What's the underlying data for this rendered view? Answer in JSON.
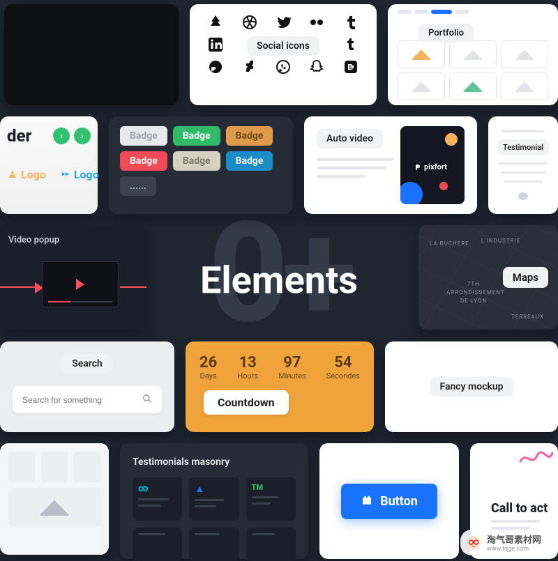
{
  "page": {
    "background_number": "0+",
    "title": "Elements"
  },
  "social": {
    "label": "Social icons"
  },
  "portfolio": {
    "label": "Portfolio"
  },
  "slider": {
    "title_fragment": "der",
    "logo_text": "Logo"
  },
  "badges": {
    "items": [
      {
        "text": "Badge",
        "bg": "#e6e8ec",
        "fg": "#9aa1ad"
      },
      {
        "text": "Badge",
        "bg": "#2fb968",
        "fg": "#ffffff"
      },
      {
        "text": "Badge",
        "bg": "#e09a4c",
        "fg": "#6b4518"
      },
      {
        "text": "Badge",
        "bg": "#ef4a56",
        "fg": "#ffffff"
      },
      {
        "text": "Badge",
        "bg": "#d6d1c1",
        "fg": "#7a7569"
      },
      {
        "text": "Badge",
        "bg": "#1c8cc9",
        "fg": "#ffffff"
      },
      {
        "text": "......",
        "bg": "#3a424f",
        "fg": "#aeb4bd"
      }
    ]
  },
  "auto_video": {
    "label": "Auto video",
    "brand": "pixfort"
  },
  "testimonial": {
    "label": "Testimonial"
  },
  "video_popup": {
    "label": "Video popup"
  },
  "maps": {
    "label": "Maps",
    "streets": [
      "LA BUCHÈRE",
      "L'INDUSTRIE",
      "7TH",
      "ARRONDISSEMENT",
      "DE LYON",
      "TERREAUX"
    ]
  },
  "search": {
    "label": "Search",
    "placeholder": "Search for something"
  },
  "countdown": {
    "label": "Countdown",
    "items": [
      {
        "value": "26",
        "unit": "Days"
      },
      {
        "value": "13",
        "unit": "Hours"
      },
      {
        "value": "97",
        "unit": "Minutes"
      },
      {
        "value": "54",
        "unit": "Secondes"
      }
    ]
  },
  "fancy_mockup": {
    "label": "Fancy mockup"
  },
  "testimonials_masonry": {
    "label": "Testimonials masonry"
  },
  "button": {
    "label": "Button"
  },
  "call_to_action": {
    "label_fragment": "Call to act"
  },
  "watermark": {
    "text": "淘气哥素材网",
    "url": "www.tqge.com"
  }
}
